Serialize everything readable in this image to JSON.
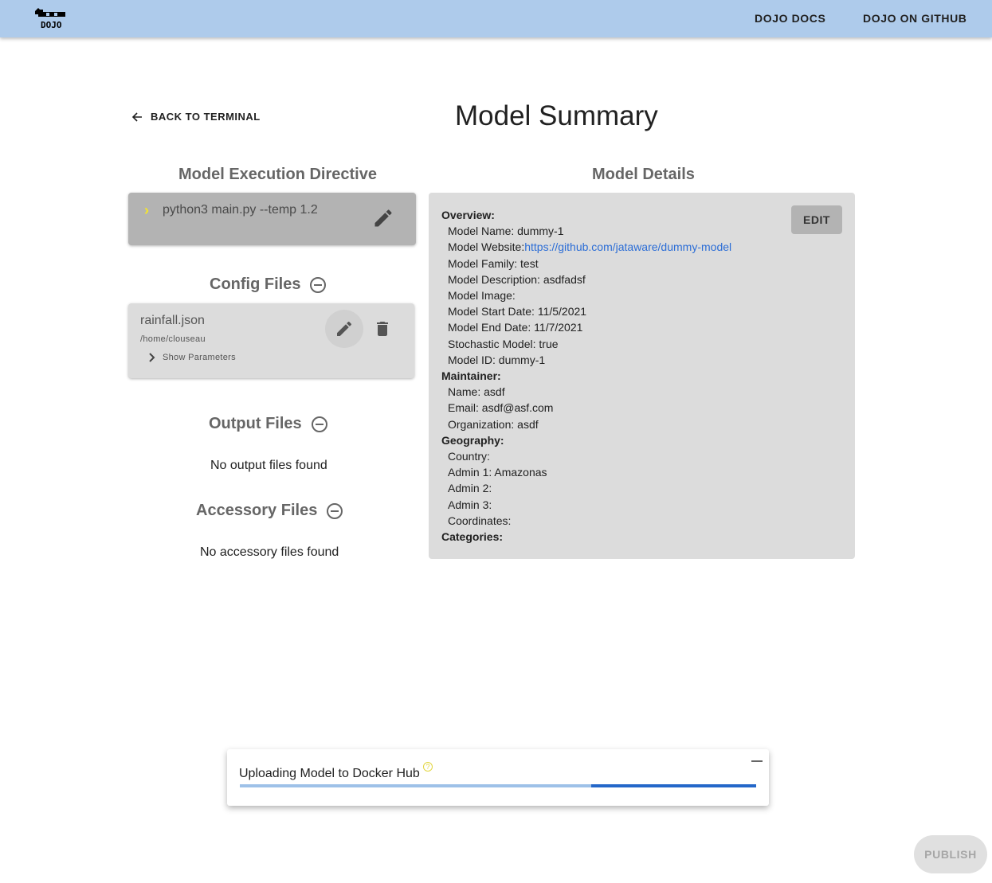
{
  "appbar": {
    "logo_text": "DOJO",
    "nav": [
      {
        "label": "DOJO DOCS"
      },
      {
        "label": "DOJO ON GITHUB"
      }
    ]
  },
  "back_link": {
    "label": "BACK TO TERMINAL",
    "icon": "arrow-left-icon"
  },
  "page_title": "Model Summary",
  "execution_directive": {
    "title": "Model Execution Directive",
    "command": "python3 main.py --temp 1.2",
    "prompt_glyph": "›"
  },
  "config_files": {
    "title": "Config Files",
    "items": [
      {
        "name": "rainfall.json",
        "path": "/home/clouseau",
        "toggle_label": "Show Parameters"
      }
    ]
  },
  "output_files": {
    "title": "Output Files",
    "empty_text": "No output files found"
  },
  "accessory_files": {
    "title": "Accessory Files",
    "empty_text": "No accessory files found"
  },
  "model_details": {
    "title": "Model Details",
    "edit_label": "EDIT",
    "overview": {
      "heading": "Overview:",
      "name": "Model Name: dummy-1",
      "website_label": "Model Website:",
      "website_url": "https://github.com/jataware/dummy-model",
      "family": "Model Family: test",
      "description": "Model Description: asdfadsf",
      "image": "Model Image:",
      "start_date": "Model Start Date: 11/5/2021",
      "end_date": "Model End Date: 11/7/2021",
      "stochastic": "Stochastic Model: true",
      "id": "Model ID: dummy-1"
    },
    "maintainer": {
      "heading": "Maintainer:",
      "name": "Name: asdf",
      "email": "Email: asdf@asf.com",
      "organization": "Organization: asdf"
    },
    "geography": {
      "heading": "Geography:",
      "country": "Country:",
      "admin1": "Admin 1: Amazonas",
      "admin2": "Admin 2:",
      "admin3": "Admin 3:",
      "coordinates": "Coordinates:"
    },
    "categories": {
      "heading": "Categories:"
    }
  },
  "upload": {
    "title": "Uploading Model to Docker Hub",
    "help_glyph": "?",
    "progress_indeterminate": true,
    "bar_start_fraction": 0.68,
    "bar_end_fraction": 1.0
  },
  "publish_label": "PUBLISH",
  "colors": {
    "appbar": "#aecbeb",
    "link": "#2b6dd6",
    "progress": "#2467c9",
    "progress_track": "#9ec1e8",
    "prompt": "#f5e52b"
  }
}
